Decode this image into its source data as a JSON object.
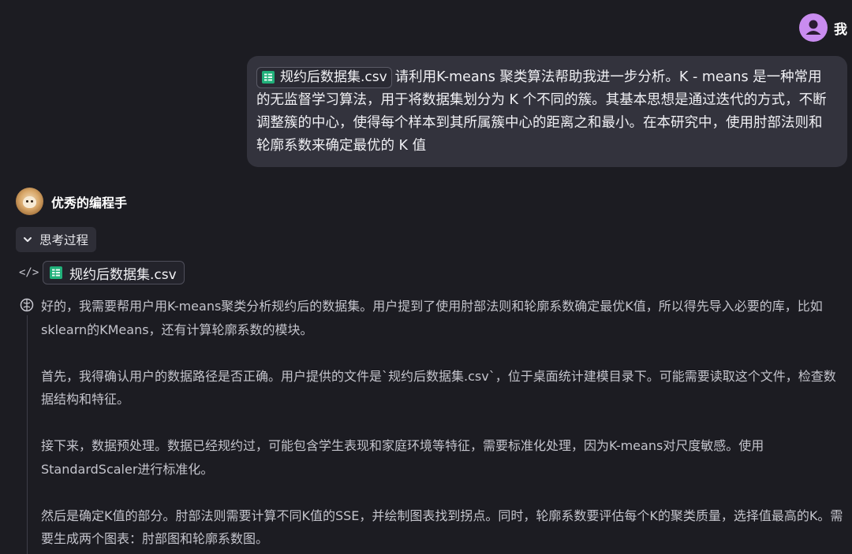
{
  "user": {
    "name": "我",
    "avatar_icon": "user-icon",
    "avatar_color": "#c98cf0"
  },
  "user_message": {
    "attachment": {
      "filename": "规约后数据集.csv",
      "icon": "spreadsheet-icon"
    },
    "text": "请利用K-means 聚类算法帮助我进一步分析。K - means 是一种常用的无监督学习算法，用于将数据集划分为 K 个不同的簇。其基本思想是通过迭代的方式，不断调整簇的中心，使得每个样本到其所属簇中心的距离之和最小。在本研究中，使用肘部法则和轮廓系数来确定最优的 K 值"
  },
  "assistant": {
    "name": "优秀的编程手",
    "thinking_label": "思考过程",
    "code_attachment": {
      "filename": "规约后数据集.csv",
      "icon": "spreadsheet-icon"
    },
    "reasoning": [
      "好的，我需要帮用户用K-means聚类分析规约后的数据集。用户提到了使用肘部法则和轮廓系数确定最优K值，所以得先导入必要的库，比如sklearn的KMeans，还有计算轮廓系数的模块。",
      "首先，我得确认用户的数据路径是否正确。用户提供的文件是`规约后数据集.csv`，位于桌面统计建模目录下。可能需要读取这个文件，检查数据结构和特征。",
      "接下来，数据预处理。数据已经规约过，可能包含学生表现和家庭环境等特征，需要标准化处理，因为K-means对尺度敏感。使用StandardScaler进行标准化。",
      "然后是确定K值的部分。肘部法则需要计算不同K值的SSE，并绘制图表找到拐点。同时，轮廓系数要评估每个K的聚类质量，选择值最高的K。需要生成两个图表：肘部图和轮廓系数图。"
    ]
  },
  "colors": {
    "background": "#1c1c22",
    "bubble": "#33333d",
    "sheet_icon": "#21b07a"
  }
}
